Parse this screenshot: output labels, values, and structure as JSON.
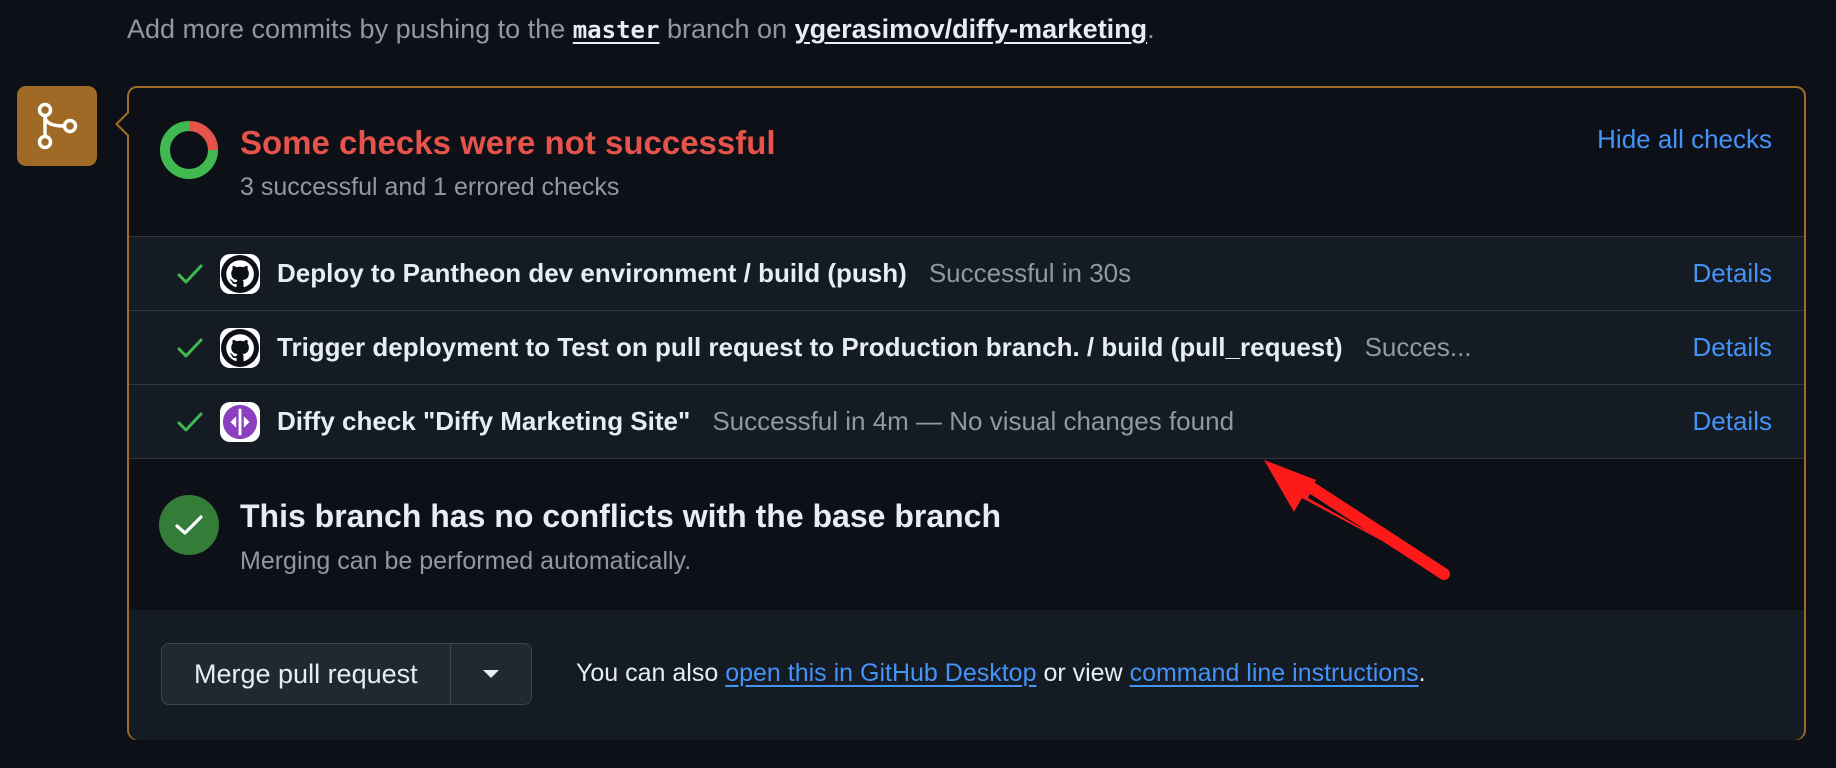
{
  "header": {
    "prefix": "Add more commits by pushing to the",
    "branch": "master",
    "middle": "branch on",
    "repo": "ygerasimov/diffy-marketing",
    "suffix": "."
  },
  "summary": {
    "title": "Some checks were not successful",
    "subtitle": "3 successful and 1 errored checks",
    "hide_label": "Hide all checks",
    "success_ratio": 0.75
  },
  "checks": [
    {
      "icon": "github-icon",
      "name": "Deploy to Pantheon dev environment / build (push)",
      "status": "Successful in 30s",
      "details": "Details"
    },
    {
      "icon": "github-icon",
      "name": "Trigger deployment to Test on pull request to Production branch. / build (pull_request)",
      "status": "Succes...",
      "details": "Details"
    },
    {
      "icon": "diffy-icon",
      "name": "Diffy check \"Diffy Marketing Site\"",
      "status": "Successful in 4m — No visual changes found",
      "details": "Details"
    }
  ],
  "conflicts": {
    "title": "This branch has no conflicts with the base branch",
    "subtitle": "Merging can be performed automatically."
  },
  "merge": {
    "button_label": "Merge pull request",
    "text_prefix": "You can also",
    "desktop_link": "open this in GitHub Desktop",
    "text_middle": "or view",
    "cli_link": "command line instructions",
    "text_suffix": "."
  },
  "colors": {
    "success": "#3fb950",
    "error": "#e5534b",
    "link": "#4493f8",
    "merge_badge": "#9e6a26",
    "annotation_arrow": "#ff1a1a"
  }
}
